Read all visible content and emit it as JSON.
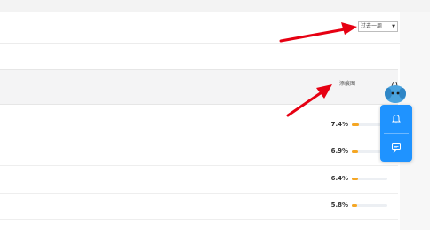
{
  "filter": {
    "period_label": "过去一周",
    "caret": "▼"
  },
  "table": {
    "column_header": "添痕图",
    "rows": [
      {
        "percent": "7.4%",
        "value": 0.074
      },
      {
        "percent": "6.9%",
        "value": 0.069
      },
      {
        "percent": "6.4%",
        "value": 0.064
      },
      {
        "percent": "5.8%",
        "value": 0.058
      }
    ]
  },
  "float_panel": {
    "icons": [
      "bell-icon",
      "chat-icon"
    ]
  },
  "colors": {
    "accent": "#1f93ff",
    "bar": "#f5a623",
    "arrow": "#e60012"
  }
}
